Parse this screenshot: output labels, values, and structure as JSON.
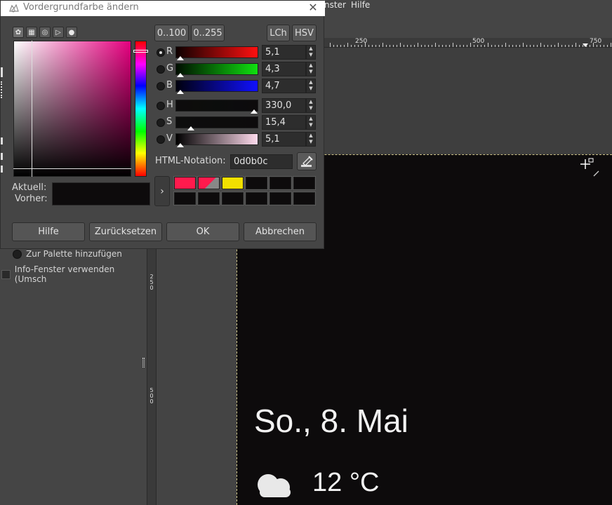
{
  "main_window": {
    "menu": [
      "nster",
      "Hilfe"
    ],
    "ruler_labels": [
      "250",
      "500",
      "750"
    ],
    "vruler_labels": [
      "2\n5\n0",
      "5\n0\n0"
    ],
    "left_options": {
      "add_to_palette": "Zur Palette hinzufügen",
      "info_window": "Info-Fenster verwenden (Umsch"
    },
    "image": {
      "date_text": "So., 8. Mai",
      "temp_text": "12 °C",
      "background_color": "#0d0b0c"
    }
  },
  "dialog": {
    "title": "Vordergrundfarbe ändern",
    "mode_icons": [
      "gimp-icon",
      "palette-icon",
      "circle-icon",
      "triangle-icon",
      "watercolor-icon"
    ],
    "range_buttons": [
      "0..100",
      "0..255"
    ],
    "model_buttons": [
      "LCh",
      "HSV"
    ],
    "channels": [
      {
        "key": "R",
        "label": "R",
        "value": "5,1",
        "fraction": 0.02,
        "selected": true
      },
      {
        "key": "G",
        "label": "G",
        "value": "4,3",
        "fraction": 0.02,
        "selected": false
      },
      {
        "key": "B",
        "label": "B",
        "value": "4,7",
        "fraction": 0.02,
        "selected": false
      },
      {
        "key": "H",
        "label": "H",
        "value": "330,0",
        "fraction": 0.92,
        "selected": false
      },
      {
        "key": "S",
        "label": "S",
        "value": "15,4",
        "fraction": 0.15,
        "selected": false
      },
      {
        "key": "V",
        "label": "V",
        "value": "5,1",
        "fraction": 0.02,
        "selected": false
      }
    ],
    "html_notation_label": "HTML-Notation:",
    "html_notation_value": "0d0b0c",
    "current_label": "Aktuell:",
    "previous_label": "Vorher:",
    "history_colors": [
      "#ff1a4d",
      "#ff1a4d",
      "#f2e000",
      "#0d0b0c",
      "#0d0b0c",
      "#0d0b0c",
      "#0d0b0c",
      "#0d0b0c",
      "#0d0b0c",
      "#0d0b0c",
      "#0d0b0c",
      "#0d0b0c"
    ],
    "buttons": {
      "help": "Hilfe",
      "reset": "Zurücksetzen",
      "ok": "OK",
      "cancel": "Abbrechen"
    }
  }
}
